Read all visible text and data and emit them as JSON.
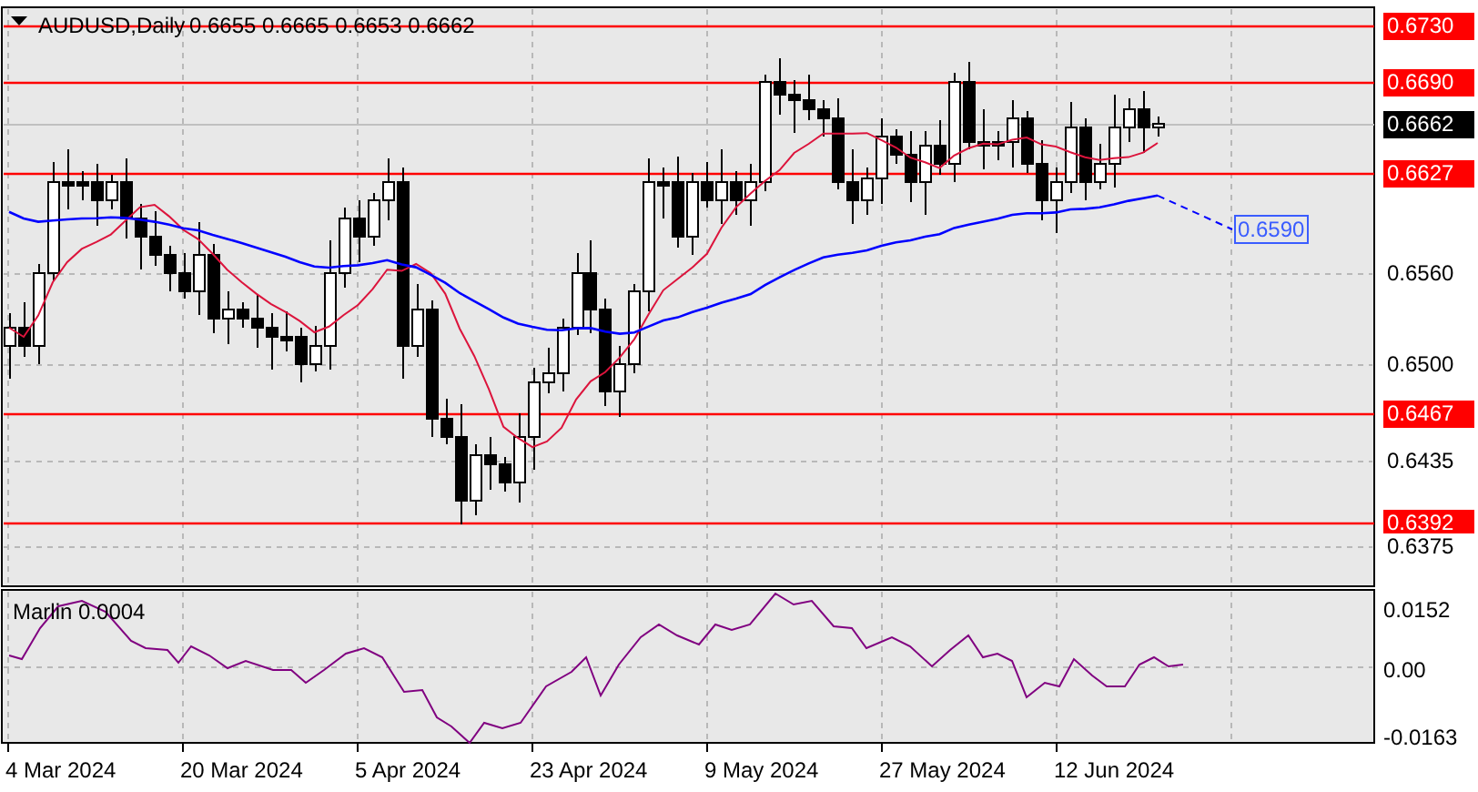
{
  "chart_header": {
    "symbol": "AUDUSD,Daily",
    "ohlc": "0.6655 0.6665 0.6653 0.6662"
  },
  "price_axis": [
    {
      "label": "0.6730",
      "kind": "level"
    },
    {
      "label": "0.6690",
      "kind": "level"
    },
    {
      "label": "0.6662",
      "kind": "price"
    },
    {
      "label": "0.6627",
      "kind": "level"
    },
    {
      "label": "0.6560",
      "kind": "tick"
    },
    {
      "label": "0.6500",
      "kind": "tick"
    },
    {
      "label": "0.6467",
      "kind": "level"
    },
    {
      "label": "0.6435",
      "kind": "tick"
    },
    {
      "label": "0.6392",
      "kind": "level"
    },
    {
      "label": "0.6375",
      "kind": "tick"
    }
  ],
  "ma_label": "0.6590",
  "indicator": {
    "title": "Marlin 0.0004",
    "axis": [
      "0.0152",
      "0.00",
      "-0.0163"
    ]
  },
  "date_axis": [
    "4 Mar 2024",
    "20 Mar 2024",
    "5 Apr 2024",
    "23 Apr 2024",
    "9 May 2024",
    "27 May 2024",
    "12 Jun 2024"
  ]
}
